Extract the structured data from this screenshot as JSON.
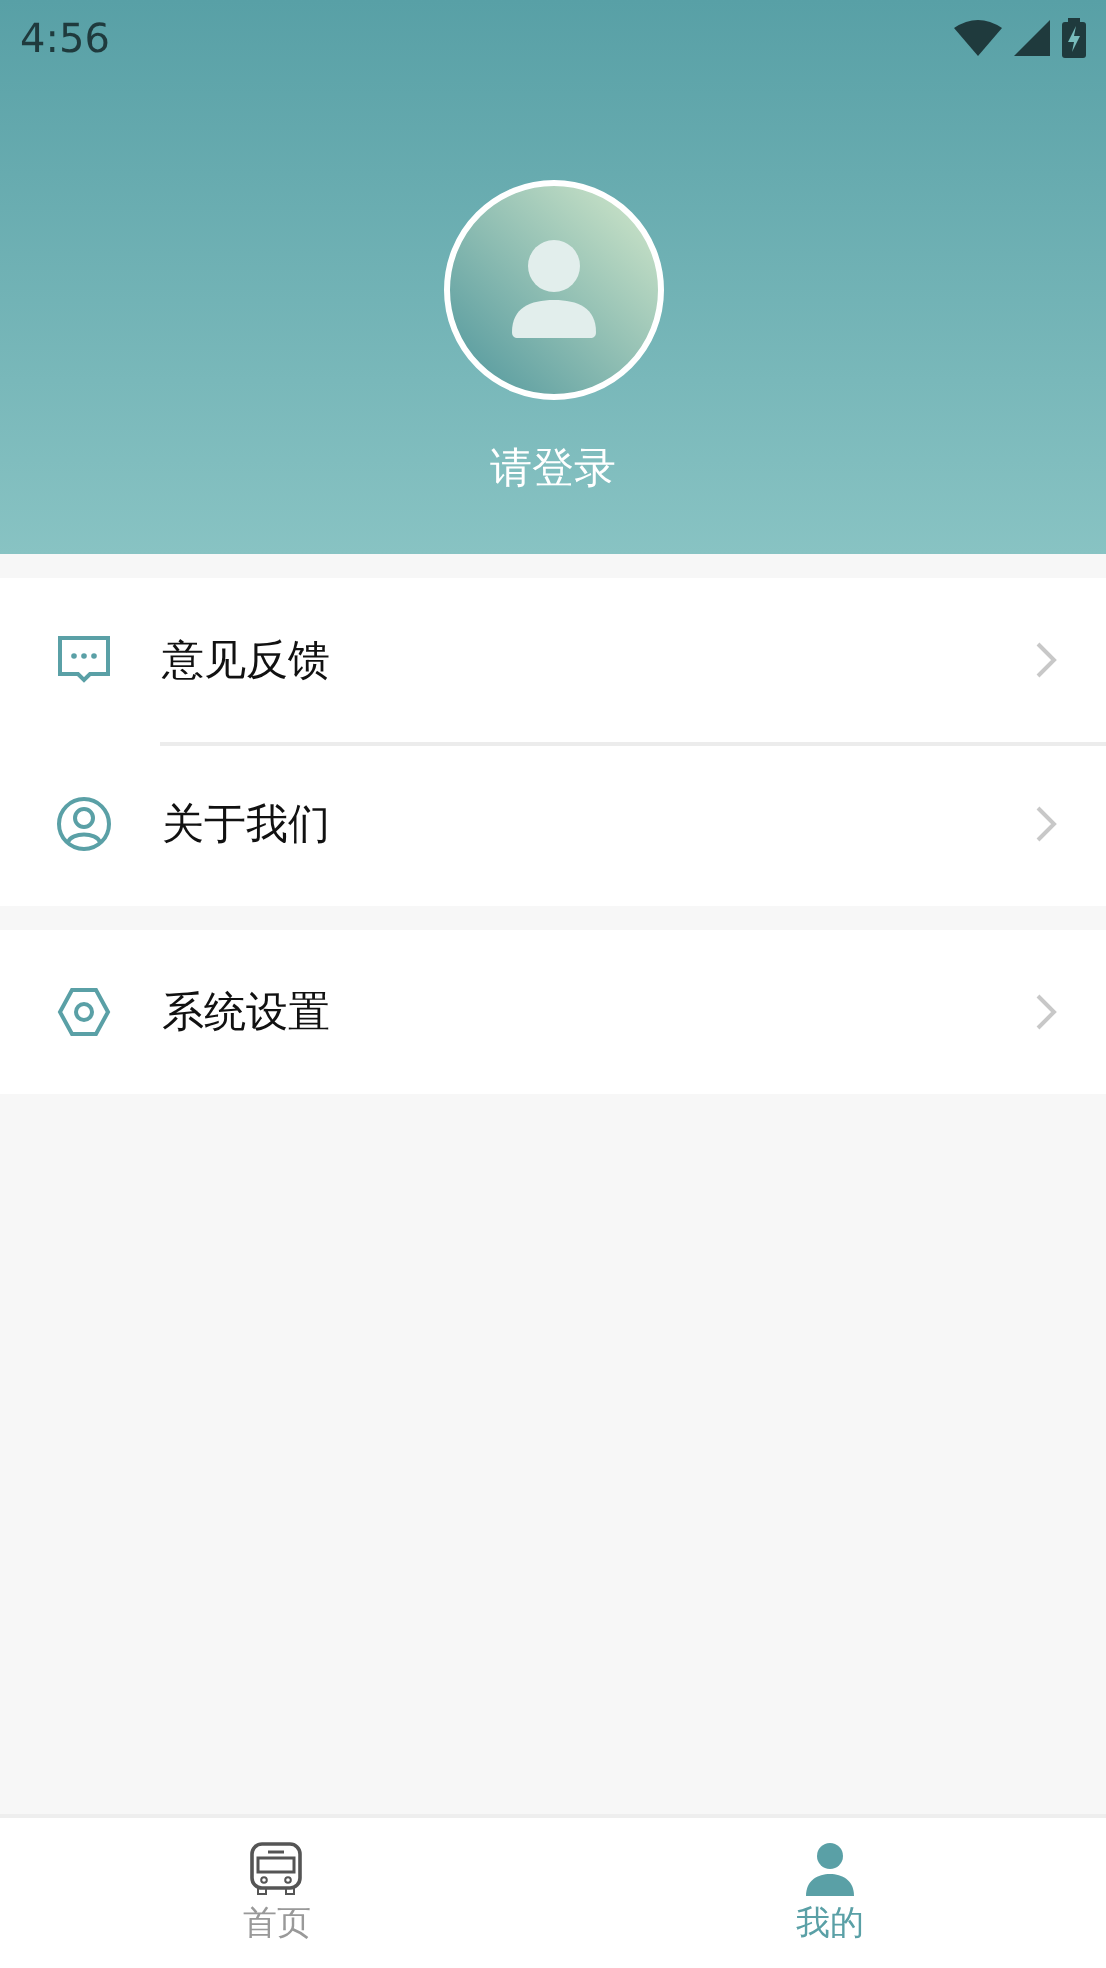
{
  "status_bar": {
    "time": "4:56"
  },
  "profile": {
    "login_label": "请登录"
  },
  "menu_groups": [
    {
      "items": [
        {
          "kind": "feedback",
          "label": "意见反馈"
        },
        {
          "kind": "about",
          "label": "关于我们"
        }
      ]
    },
    {
      "items": [
        {
          "kind": "settings",
          "label": "系统设置"
        }
      ]
    }
  ],
  "tab_bar": [
    {
      "kind": "home",
      "label": "首页",
      "selected": false
    },
    {
      "kind": "mine",
      "label": "我的",
      "selected": true
    }
  ]
}
